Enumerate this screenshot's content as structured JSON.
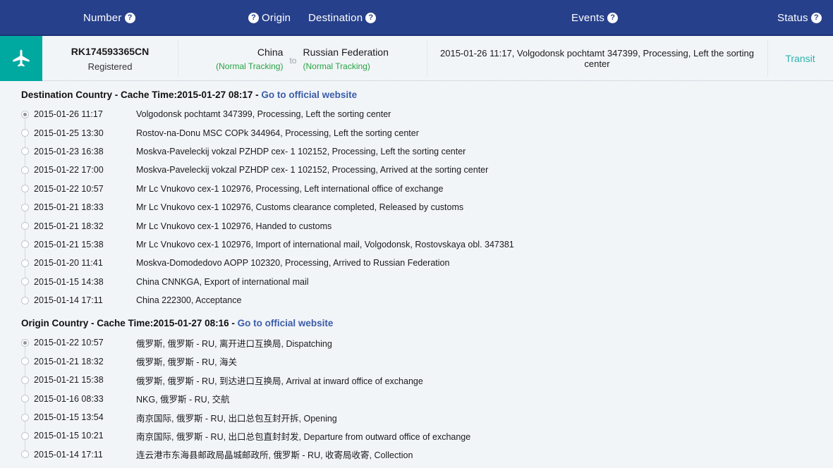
{
  "header": {
    "columns": [
      {
        "label": "Number",
        "help_icon": "help-circle-icon",
        "icon_side": "right"
      },
      {
        "label": "Origin",
        "help_icon": "help-circle-icon",
        "icon_side": "left"
      },
      {
        "label": "Destination",
        "help_icon": "help-circle-icon",
        "icon_side": "right"
      },
      {
        "label": "Events",
        "help_icon": "help-circle-icon",
        "icon_side": "right"
      },
      {
        "label": "Status",
        "help_icon": "help-circle-icon",
        "icon_side": "right"
      }
    ],
    "help_glyph": "?",
    "background_color": "#27408b"
  },
  "summary": {
    "transport_icon": "airplane-icon",
    "transport_icon_bg": "#00a9a0",
    "tracking_number": "RK174593365CN",
    "service_type": "Registered",
    "origin_country": "China",
    "origin_tracking_mode": "(Normal Tracking)",
    "route_separator": "to",
    "destination_country": "Russian Federation",
    "destination_tracking_mode": "(Normal Tracking)",
    "latest_event": "2015-01-26 11:17, Volgodonsk pochtamt 347399, Processing, Left the sorting center",
    "status": "Transit",
    "status_color": "#2bb3ae",
    "tracking_mode_color": "#27a343"
  },
  "sections": [
    {
      "title_prefix": "Destination Country - Cache Time:",
      "cache_time": "2015-01-27 08:17",
      "link_label": "Go to official website",
      "dash": " - ",
      "events": [
        {
          "time": "2015-01-26 11:17",
          "description": "Volgodonsk pochtamt 347399, Processing, Left the sorting center",
          "active": true
        },
        {
          "time": "2015-01-25 13:30",
          "description": "Rostov-na-Donu MSC COPk 344964, Processing, Left the sorting center",
          "active": false
        },
        {
          "time": "2015-01-23 16:38",
          "description": "Moskva-Paveleckij vokzal PZHDP cex- 1 102152, Processing, Left the sorting center",
          "active": false
        },
        {
          "time": "2015-01-22 17:00",
          "description": "Moskva-Paveleckij vokzal PZHDP cex- 1 102152, Processing, Arrived at the sorting center",
          "active": false
        },
        {
          "time": "2015-01-22 10:57",
          "description": "Mr Lc Vnukovo cex-1 102976, Processing, Left international office of exchange",
          "active": false
        },
        {
          "time": "2015-01-21 18:33",
          "description": "Mr Lc Vnukovo cex-1 102976, Customs clearance completed, Released by customs",
          "active": false
        },
        {
          "time": "2015-01-21 18:32",
          "description": "Mr Lc Vnukovo cex-1 102976, Handed to customs",
          "active": false
        },
        {
          "time": "2015-01-21 15:38",
          "description": "Mr Lc Vnukovo cex-1 102976, Import of international mail, Volgodonsk, Rostovskaya obl. 347381",
          "active": false
        },
        {
          "time": "2015-01-20 11:41",
          "description": "Moskva-Domodedovo AOPP 102320, Processing, Arrived to Russian Federation",
          "active": false
        },
        {
          "time": "2015-01-15 14:38",
          "description": "China CNNKGA, Export of international mail",
          "active": false
        },
        {
          "time": "2015-01-14 17:11",
          "description": "China 222300, Acceptance",
          "active": false
        }
      ]
    },
    {
      "title_prefix": "Origin Country - Cache Time:",
      "cache_time": "2015-01-27 08:16",
      "link_label": "Go to official website",
      "dash": " - ",
      "events": [
        {
          "time": "2015-01-22 10:57",
          "description": "俄罗斯, 俄罗斯 - RU, 离开进口互换局, Dispatching",
          "active": true
        },
        {
          "time": "2015-01-21 18:32",
          "description": "俄罗斯, 俄罗斯 - RU, 海关",
          "active": false
        },
        {
          "time": "2015-01-21 15:38",
          "description": "俄罗斯, 俄罗斯 - RU, 到达进口互换局, Arrival at inward office of exchange",
          "active": false
        },
        {
          "time": "2015-01-16 08:33",
          "description": "NKG, 俄罗斯 - RU, 交航",
          "active": false
        },
        {
          "time": "2015-01-15 13:54",
          "description": "南京国际, 俄罗斯 - RU, 出口总包互封开拆, Opening",
          "active": false
        },
        {
          "time": "2015-01-15 10:21",
          "description": "南京国际, 俄罗斯 - RU, 出口总包直封封发, Departure from outward office of exchange",
          "active": false
        },
        {
          "time": "2015-01-14 17:11",
          "description": "连云港市东海县邮政局晶城邮政所, 俄罗斯 - RU, 收寄局收寄, Collection",
          "active": false
        }
      ]
    }
  ]
}
